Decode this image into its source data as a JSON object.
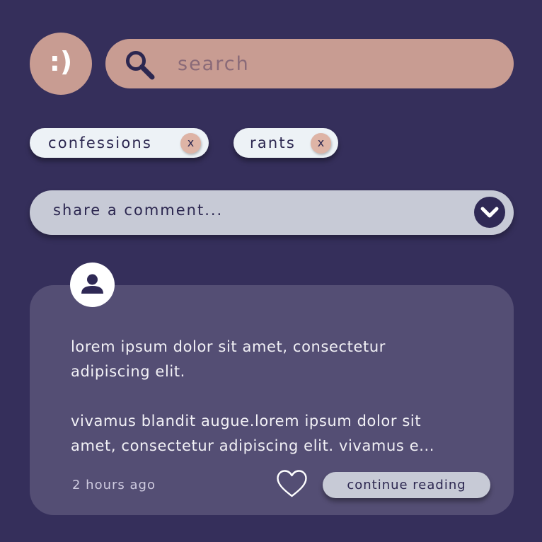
{
  "profile": {
    "emoticon": ":)"
  },
  "search": {
    "placeholder": "search",
    "value": ""
  },
  "filters": [
    {
      "label": "confessions",
      "remove": "x"
    },
    {
      "label": "rants",
      "remove": "x"
    }
  ],
  "comment_box": {
    "placeholder": "share a comment..."
  },
  "post": {
    "lines": [
      "lorem ipsum dolor sit amet, consectetur",
      "adipiscing elit.",
      "vivamus blandit augue.lorem ipsum dolor sit",
      "amet, consectetur adipiscing elit. vivamus e..."
    ],
    "timestamp": "2 hours ago",
    "continue_label": "continue reading"
  },
  "colors": {
    "background": "#352f5b",
    "accent_peach": "#c89c92",
    "chip_bg": "#edf2f6",
    "card_bg": "#544e74",
    "button_gray": "#c7cad6"
  }
}
